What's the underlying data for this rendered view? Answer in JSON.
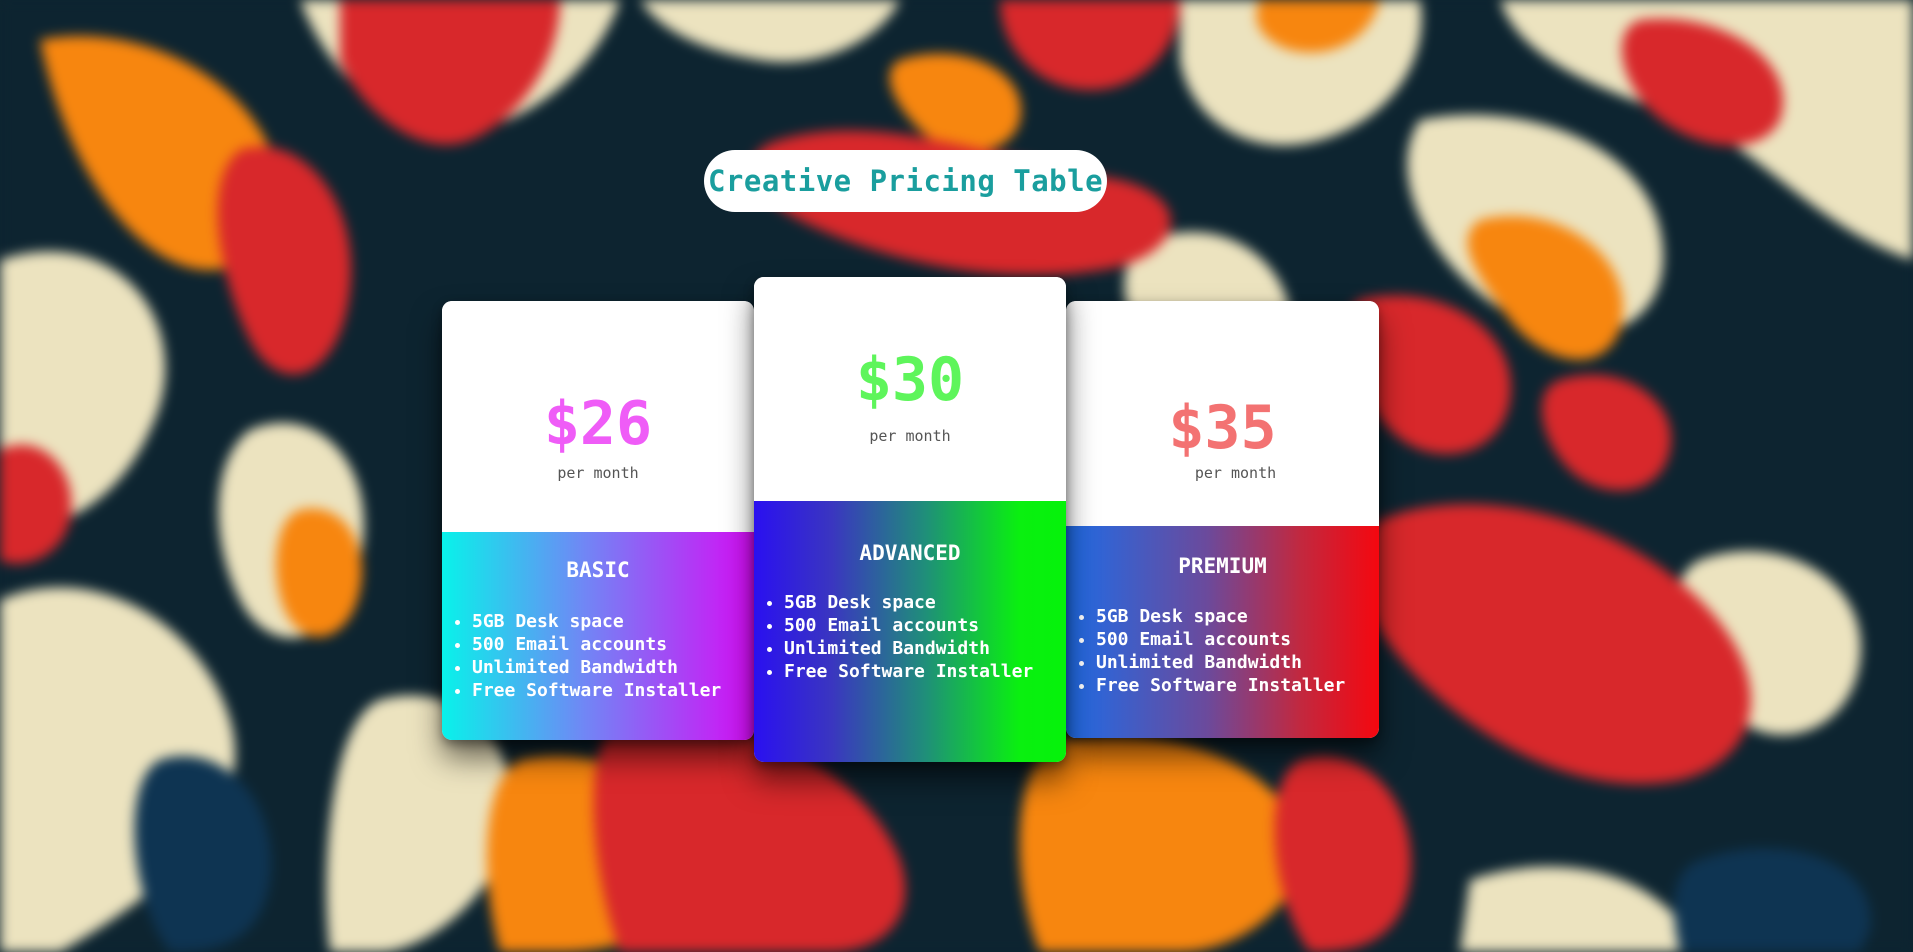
{
  "page": {
    "title": "Creative Pricing Table"
  },
  "plans": [
    {
      "name": "BASIC",
      "price": "$26",
      "period": "per month",
      "features": [
        "5GB Desk space",
        "500 Email accounts",
        "Unlimited Bandwidth",
        "Free Software Installer"
      ]
    },
    {
      "name": "ADVANCED",
      "price": "$30",
      "period": "per month",
      "features": [
        "5GB Desk space",
        "500 Email accounts",
        "Unlimited Bandwidth",
        "Free Software Installer"
      ]
    },
    {
      "name": "PREMIUM",
      "price": "$35",
      "period": "per month",
      "features": [
        "5GB Desk space",
        "500 Email accounts",
        "Unlimited Bandwidth",
        "Free Software Installer"
      ]
    }
  ],
  "colors": {
    "title_text": "#1a9e9e",
    "basic_price": "#ef5cf7",
    "advanced_price": "#5ef55b",
    "premium_price": "#f37272"
  }
}
